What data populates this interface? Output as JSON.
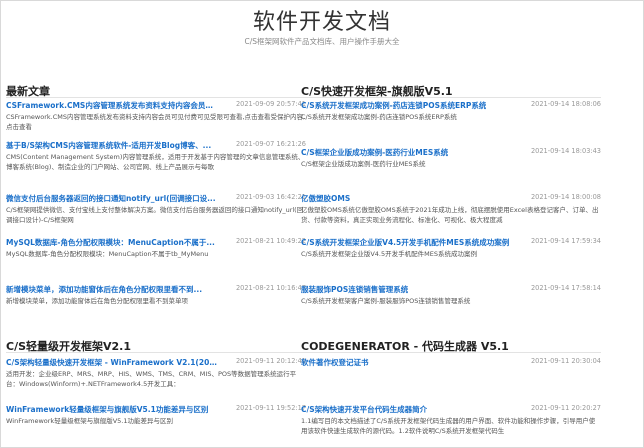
{
  "header": {
    "title": "软件开发文档",
    "subtitle": "C/S框架网软件产品文档库、用户操作手册大全"
  },
  "sections": [
    {
      "title": "最新文章",
      "items": [
        {
          "title": "CSFramework.CMS内容管理系统发布资料支持内容会员可...",
          "date": "2021-09-09 20:57:41",
          "desc": "CSFramework.CMS内容管理系统发布资料支持内容会员可见付费可见受限可查看,点击查看受保护内容,点击查看"
        },
        {
          "title": "基于B/S架构CMS内容管理系统软件-适用开发Blog博客、...",
          "date": "2021-09-07 16:21:26",
          "desc": "CMS(Content Management System)内容管理系统，适用于开发基于内容管理的文章信息管理系统、博客系统(Blog)、制造企业的门户网站、公司官网、线上产品展示与每歌"
        },
        {
          "title": "微信支付后台服务器返回的接口通知notify_url(回调接口设...",
          "date": "2021-09-03 16:42:21",
          "desc": "C/S框架网提供微信、支付宝线上支付整体解决方案。微信支付后台服务器返回的接口通知notify_url(回调接口设计)-C/S框架网"
        },
        {
          "title": "MySQL数据库-角色分配权限模块：MenuCaption不属于...",
          "date": "2021-08-21 10:49:22",
          "desc": "MySQL数据库-角色分配权限模块：MenuCaption不属于tb_MyMenu"
        },
        {
          "title": "新增模块菜单，添加功能窗体后在角色分配权限里看不到...",
          "date": "2021-08-21 10:16:47",
          "desc": "新增模块菜单，添加功能窗体后在角色分配权限里看不到菜单项"
        }
      ]
    },
    {
      "title": "C/S快速开发框架-旗舰版V5.1",
      "items": [
        {
          "title": "C/S系统开发框架成功案例-药店连锁POS系统ERP系统",
          "date": "2021-09-14 18:08:06",
          "desc": "C/S系统开发框架成功案例-药店连锁POS系统ERP系统"
        },
        {
          "title": "C/S框架企业版成功案例-医药行业MES系统",
          "date": "2021-09-14 18:03:43",
          "desc": "C/S框架企业版成功案例-医药行业MES系统"
        },
        {
          "title": "亿傲塑胶OMS",
          "date": "2021-09-14 18:00:08",
          "desc": "亿傲塑胶OMS系统亿傲塑胶OMS系统于2021年成功上线，彻底摆脱使用Excel表格登记客户、订单、出货、付款等资料，真正实现业务流程化、标准化、可视化、极大程度减"
        },
        {
          "title": "C/S系统开发框架企业版V4.5开发手机配件MES系统成功案例",
          "date": "2021-09-14 17:59:34",
          "desc": "C/S系统开发框架企业版V4.5开发手机配件MES系统成功案例"
        },
        {
          "title": "服装服饰POS连锁销售管理系统",
          "date": "2021-09-14 17:58:14",
          "desc": "C/S系统开发框架客户案例-服装服饰POS连锁销售管理系统"
        }
      ]
    },
    {
      "title": "C/S轻量级开发框架V2.1",
      "items": [
        {
          "title": "C/S架构轻量级快速开发框架 - WinFramework V2.1(2021...",
          "date": "2021-09-11 20:12:41",
          "desc": "适用开发：企业级ERP、MRS、MRP、HIS、WMS、TMS、CRM、MIS、POS等数据管理系统运行平台：Windows(Winform)+.NETFramework4.5开发工具："
        },
        {
          "title": "WinFramework轻量级框架与旗舰版V5.1功能差异与区别",
          "date": "2021-09-11 19:52:17",
          "desc": "WinFramework轻量级框架与旗舰版V5.1功能差异与区别"
        }
      ]
    },
    {
      "title": "CODEGENERATOR - 代码生成器 V5.1",
      "items": [
        {
          "title": "软件著作权登记证书",
          "date": "2021-09-11 20:30:04",
          "desc": ""
        },
        {
          "title": "C/S架构快速开发平台代码生成器简介",
          "date": "2021-09-11 20:20:27",
          "desc": "1.1编写目的本文档描述了C/S系统开发框架代码生成器的用户界面、软件功能和操作步骤，引导用户使用该软件快速生成软件的源代码。1.2软件说明C/S系统开发框架代码生"
        }
      ]
    }
  ]
}
